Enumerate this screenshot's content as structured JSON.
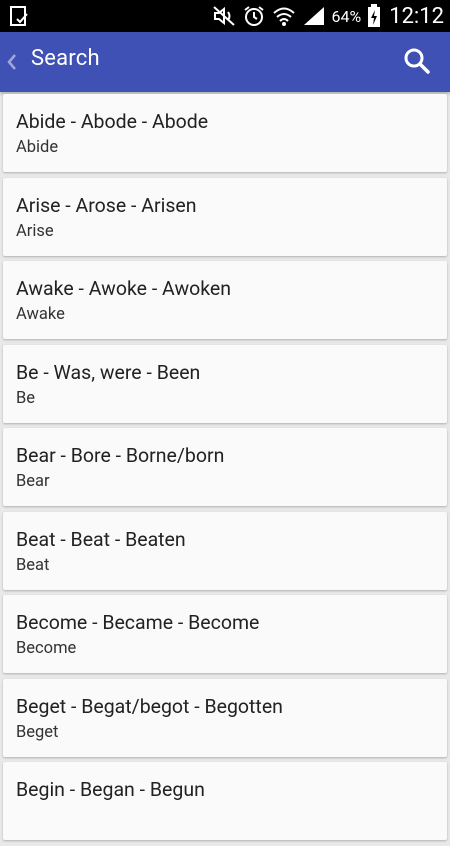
{
  "status_bar": {
    "battery_percent": "64%",
    "time": "12:12",
    "icons": [
      "notification-clipboard-icon",
      "silent-mode-icon",
      "alarm-icon",
      "wifi-icon",
      "signal-icon",
      "battery-charging-icon"
    ]
  },
  "action_bar": {
    "title": "Search",
    "back_icon": "chevron-left-icon",
    "search_icon": "search-icon",
    "color": "#3f51b5"
  },
  "verbs": [
    {
      "forms": "Abide - Abode - Abode",
      "base": "Abide"
    },
    {
      "forms": "Arise - Arose - Arisen",
      "base": "Arise"
    },
    {
      "forms": "Awake - Awoke - Awoken",
      "base": "Awake"
    },
    {
      "forms": "Be - Was, were - Been",
      "base": "Be"
    },
    {
      "forms": "Bear - Bore - Borne/born",
      "base": "Bear"
    },
    {
      "forms": "Beat - Beat - Beaten",
      "base": "Beat"
    },
    {
      "forms": "Become - Became - Become",
      "base": "Become"
    },
    {
      "forms": "Beget - Begat/begot - Begotten",
      "base": "Beget"
    },
    {
      "forms": "Begin - Began - Begun",
      "base": ""
    }
  ]
}
